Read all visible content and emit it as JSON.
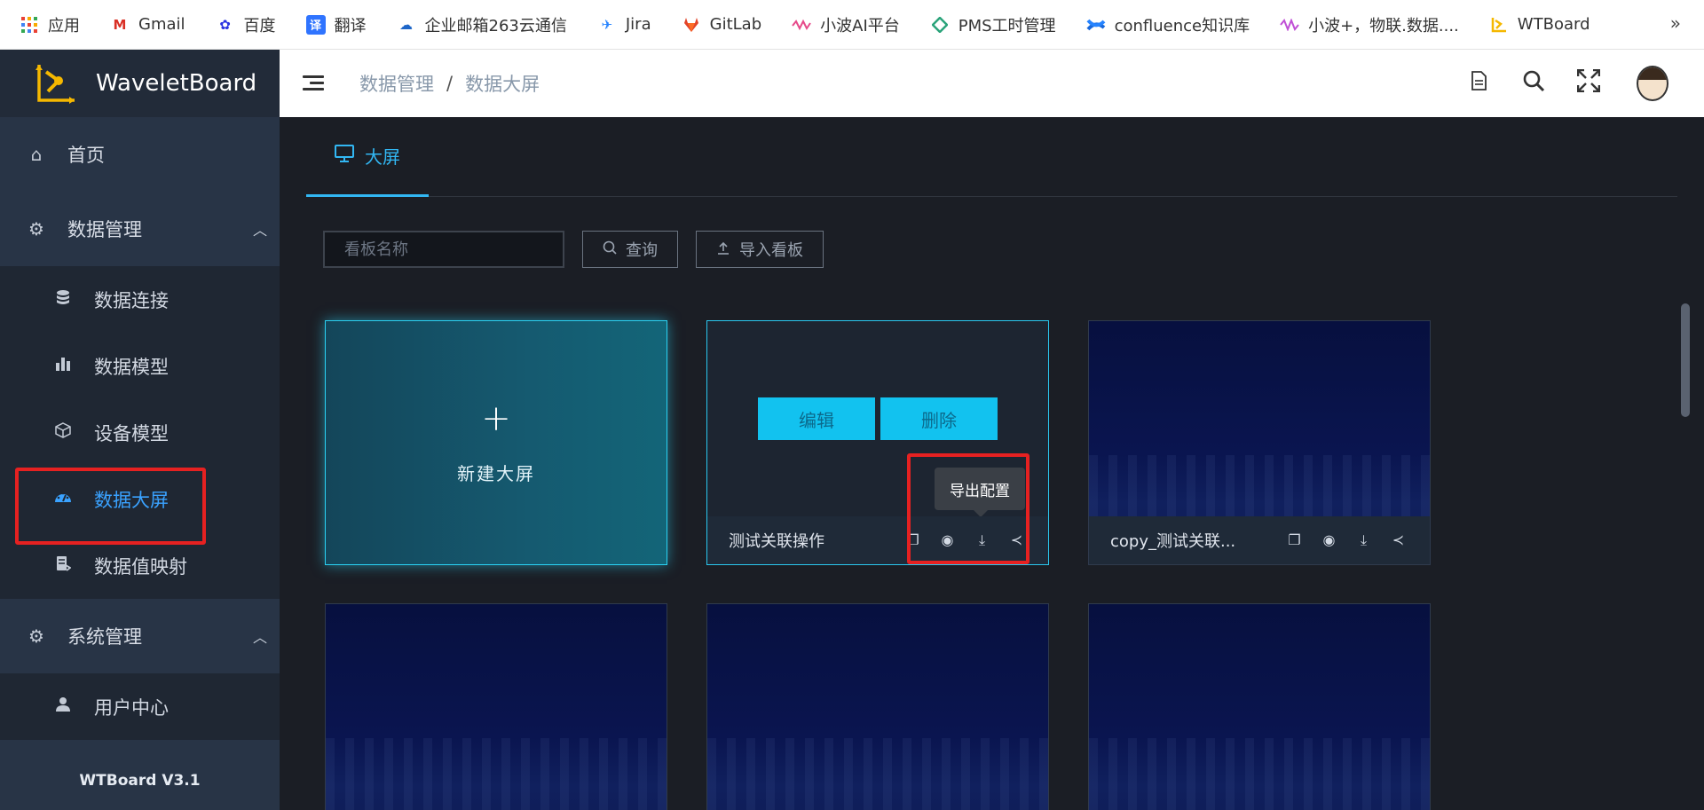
{
  "bookmarks": [
    {
      "label": "应用",
      "icon": "apps-grid-icon",
      "color": "#e94235"
    },
    {
      "label": "Gmail",
      "icon": "gmail-icon",
      "color": "#d93025"
    },
    {
      "label": "百度",
      "icon": "baidu-paw-icon",
      "color": "#2932e1"
    },
    {
      "label": "翻译",
      "icon": "translate-icon",
      "color": "#2f74ff"
    },
    {
      "label": "企业邮箱263云通信",
      "icon": "cloud-mail-icon",
      "color": "#1e66c8"
    },
    {
      "label": "Jira",
      "icon": "jira-icon",
      "color": "#2684ff"
    },
    {
      "label": "GitLab",
      "icon": "gitlab-icon",
      "color": "#e24329"
    },
    {
      "label": "小波AI平台",
      "icon": "wave-icon",
      "color": "#e64a8a"
    },
    {
      "label": "PMS工时管理",
      "icon": "pms-icon",
      "color": "#2aa37a"
    },
    {
      "label": "confluence知识库",
      "icon": "confluence-icon",
      "color": "#1868db"
    },
    {
      "label": "小波+，物联.数据....",
      "icon": "wave-plus-icon",
      "color": "#c04fd6"
    },
    {
      "label": "WTBoard",
      "icon": "wtboard-logo-icon",
      "color": "#f5b800"
    }
  ],
  "bookmarks_more": "»",
  "sidebar": {
    "app_name": "WaveletBoard",
    "home": "首页",
    "data_group": "数据管理",
    "data_items": [
      {
        "label": "数据连接",
        "icon": "database-icon"
      },
      {
        "label": "数据模型",
        "icon": "bar-chart-icon"
      },
      {
        "label": "设备模型",
        "icon": "cube-icon"
      },
      {
        "label": "数据大屏",
        "icon": "dashboard-gauge-icon"
      },
      {
        "label": "数据值映射",
        "icon": "mapping-doc-icon"
      }
    ],
    "system_group": "系统管理",
    "system_items": [
      {
        "label": "用户中心",
        "icon": "user-icon"
      }
    ],
    "version": "WTBoard V3.1",
    "active_item": "数据大屏"
  },
  "header": {
    "breadcrumb": [
      "数据管理",
      "数据大屏"
    ],
    "separator": "/"
  },
  "main": {
    "tab_label": "大屏",
    "search_placeholder": "看板名称",
    "query_button": "查询",
    "import_button": "导入看板",
    "new_card_label": "新建大屏",
    "new_card_plus": "+",
    "edit_button": "编辑",
    "delete_button": "删除",
    "tooltip": "导出配置",
    "cards": [
      {
        "name": "测试关联操作"
      },
      {
        "name": "copy_测试关联..."
      }
    ]
  },
  "colors": {
    "accent": "#32b7f3",
    "active_nav": "#3aa2ff",
    "highlight_box": "#e62121",
    "edit_button_bg": "#12c2ef"
  }
}
